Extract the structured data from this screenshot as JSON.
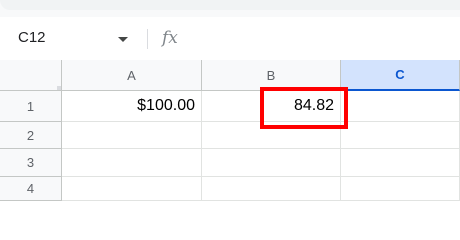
{
  "name_box": {
    "value": "C12"
  },
  "formula_bar": {
    "icon": "fx-icon",
    "label": "fx"
  },
  "columns": [
    {
      "label": "A"
    },
    {
      "label": "B"
    },
    {
      "label": "C"
    }
  ],
  "rows": [
    {
      "label": "1",
      "cells": [
        "$100.00",
        "84.82",
        ""
      ]
    },
    {
      "label": "2",
      "cells": [
        "",
        "",
        ""
      ]
    },
    {
      "label": "3",
      "cells": [
        "",
        "",
        ""
      ]
    },
    {
      "label": "4",
      "cells": [
        "",
        "",
        ""
      ]
    }
  ],
  "selected_column": "C",
  "colors": {
    "highlight": "#ff0000",
    "selected_header_bg": "#d3e3fd",
    "selected_header_text": "#0b57d0"
  }
}
